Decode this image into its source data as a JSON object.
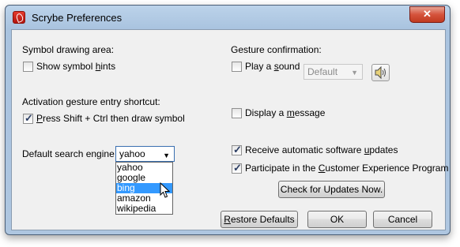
{
  "window": {
    "title": "Scrybe Preferences",
    "close_label": "✕"
  },
  "symbol_area": {
    "heading": "Symbol drawing area:",
    "show_hints_pre": "Show symbol ",
    "show_hints_key": "h",
    "show_hints_post": "ints",
    "show_hints_checked": false
  },
  "activation": {
    "heading": "Activation gesture entry shortcut:",
    "option_key": "P",
    "option_post": "ress Shift + Ctrl then draw symbol",
    "option_checked": true
  },
  "search": {
    "label": "Default search engine",
    "selected": "yahoo",
    "options": [
      "yahoo",
      "google",
      "bing",
      "amazon",
      "wikipedia"
    ],
    "highlighted": "bing"
  },
  "gesture": {
    "heading": "Gesture confirmation:",
    "play_sound_pre": "Play a ",
    "play_sound_key": "s",
    "play_sound_post": "ound",
    "play_sound_checked": false,
    "sound_value": "Default",
    "display_msg_pre": "Display a ",
    "display_msg_key": "m",
    "display_msg_post": "essage",
    "display_msg_checked": false
  },
  "updates": {
    "receive_pre": "Receive automatic software ",
    "receive_key": "u",
    "receive_post": "pdates",
    "receive_checked": true,
    "participate_pre": "Participate in the ",
    "participate_key": "C",
    "participate_post": "ustomer Experience Program",
    "participate_checked": true,
    "check_button": "Check for Updates Now."
  },
  "buttons": {
    "restore_key": "R",
    "restore_post": "estore Defaults",
    "ok": "OK",
    "cancel": "Cancel"
  },
  "icons": {
    "app": "scrybe-app-icon",
    "sound": "speaker-icon",
    "cursor": "mouse-pointer-icon"
  }
}
